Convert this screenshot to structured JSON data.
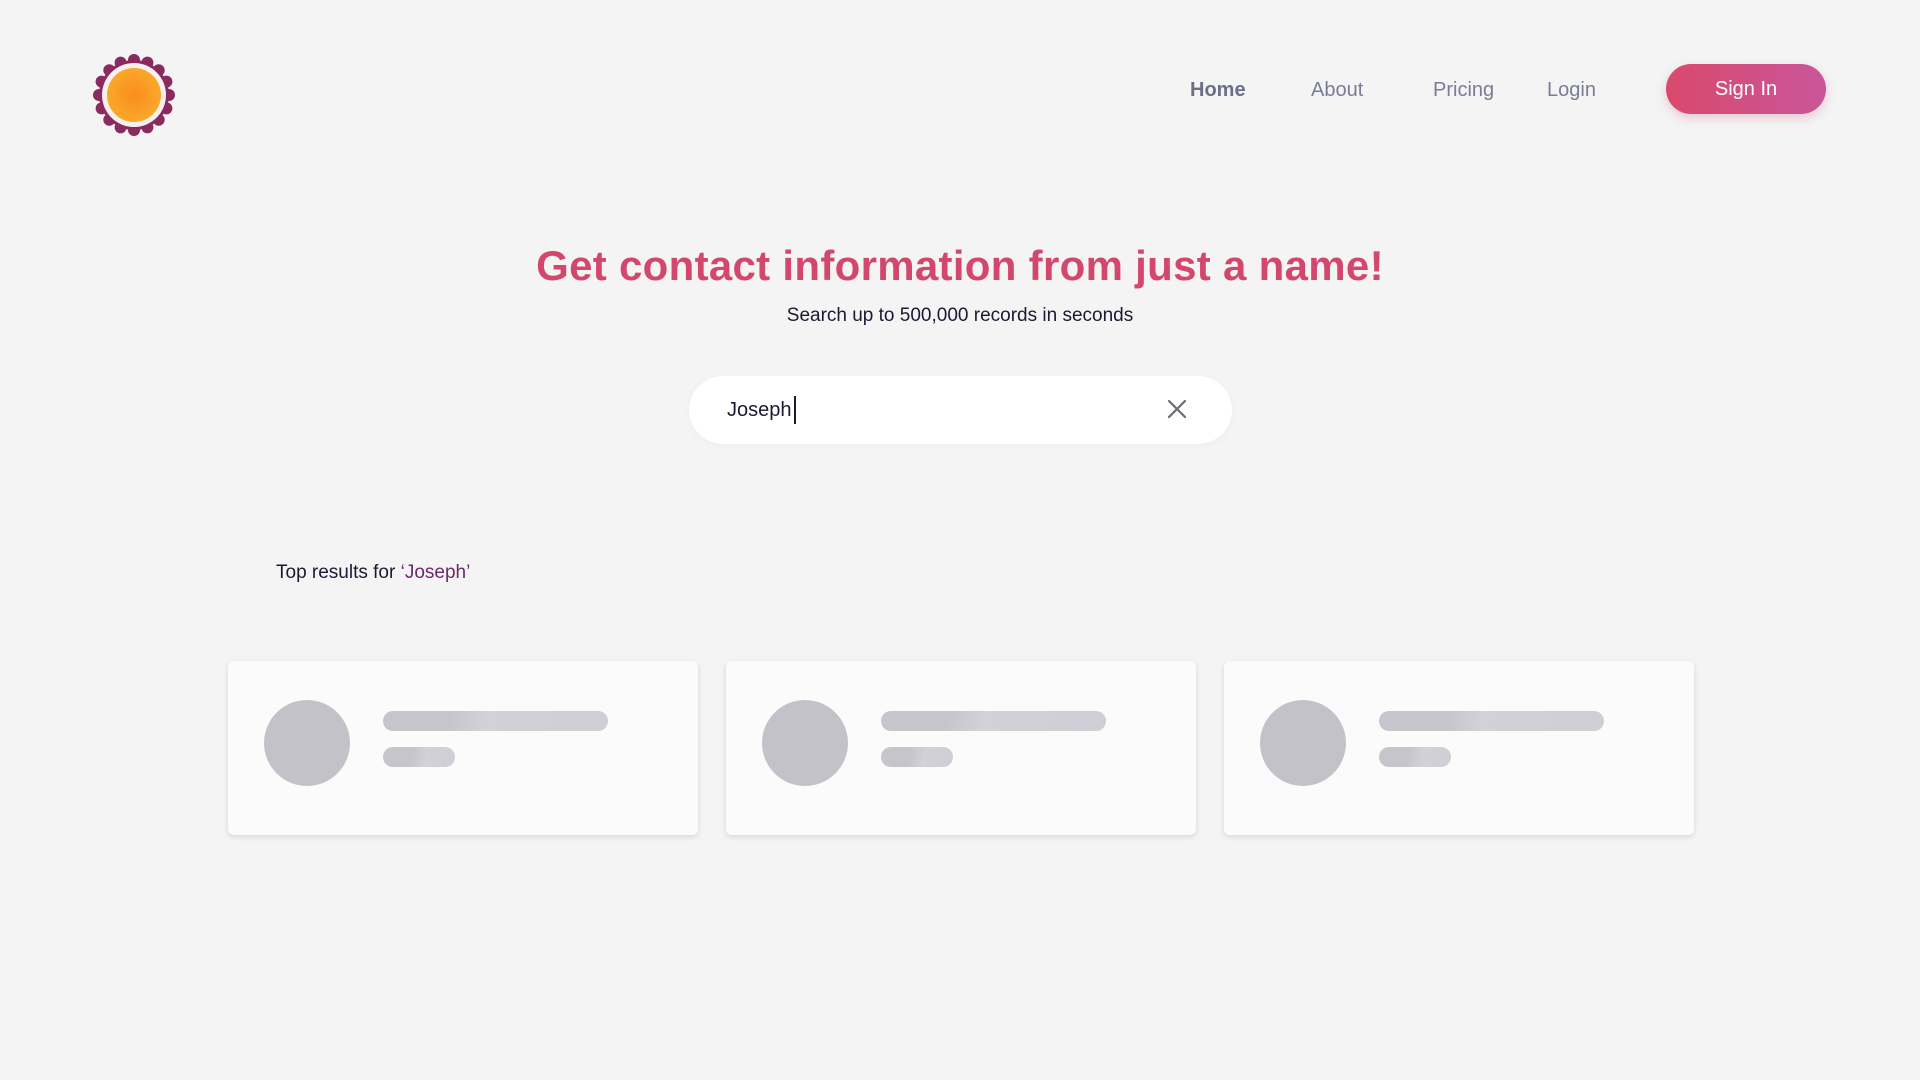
{
  "nav": {
    "items": [
      {
        "label": "Home",
        "active": true
      },
      {
        "label": "About",
        "active": false
      },
      {
        "label": "Pricing",
        "active": false
      },
      {
        "label": "Login",
        "active": false
      }
    ],
    "signin_label": "Sign In"
  },
  "hero": {
    "title": "Get contact information from just a name!",
    "subtitle": "Search up to 500,000 records in seconds"
  },
  "search": {
    "value": "Joseph",
    "clear_icon": "close-icon"
  },
  "results": {
    "prefix": "Top results for ",
    "query": "‘Joseph’",
    "cards_loading": 3
  },
  "colors": {
    "accent": "#d4476d",
    "button_gradient_start": "#d9496c",
    "button_gradient_end": "#c9569a",
    "query_highlight": "#6a2a6c",
    "logo_ring": "#8b2a5e",
    "logo_core": "#f7a21e",
    "skeleton": "#c3c2c9"
  },
  "icons": {
    "logo": "sun-flower-logo-icon",
    "clear": "close-icon"
  }
}
